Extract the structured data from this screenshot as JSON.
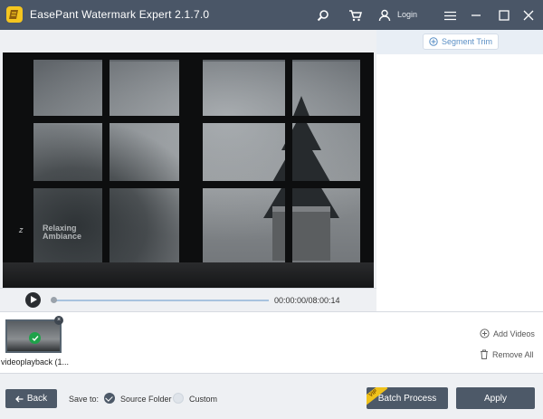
{
  "app": {
    "title": "EasePant Watermark Expert  2.1.7.0",
    "login_label": "Login"
  },
  "icons": {
    "logo": "easepant-logo-icon",
    "search": "search-icon",
    "cart": "cart-icon",
    "user": "user-icon",
    "menu": "menu-icon",
    "minimize": "minimize-icon",
    "maximize": "maximize-icon",
    "close": "close-icon"
  },
  "preview": {
    "watermark_prefix": "Z",
    "watermark_text": "Relaxing Ambiance"
  },
  "player": {
    "time_display": "00:00:00/08:00:14",
    "progress_fraction": 0.0
  },
  "segment": {
    "button_label": "Segment Trim"
  },
  "files": {
    "items": [
      {
        "label": "videoplayback (1...",
        "selected": true
      }
    ],
    "add_videos_label": "Add Videos",
    "remove_all_label": "Remove All"
  },
  "bottom": {
    "back_label": "Back",
    "save_to_label": "Save to:",
    "source_folder_label": "Source Folder",
    "custom_label": "Custom",
    "save_to_selected": "Source Folder",
    "vip_badge": "VIP",
    "batch_label": "Batch Process",
    "apply_label": "Apply"
  },
  "colors": {
    "titlebar": "#4a5667",
    "accent_blue": "#5a8fc5",
    "logo_yellow": "#f4c51f",
    "check_green": "#1fa24a"
  }
}
